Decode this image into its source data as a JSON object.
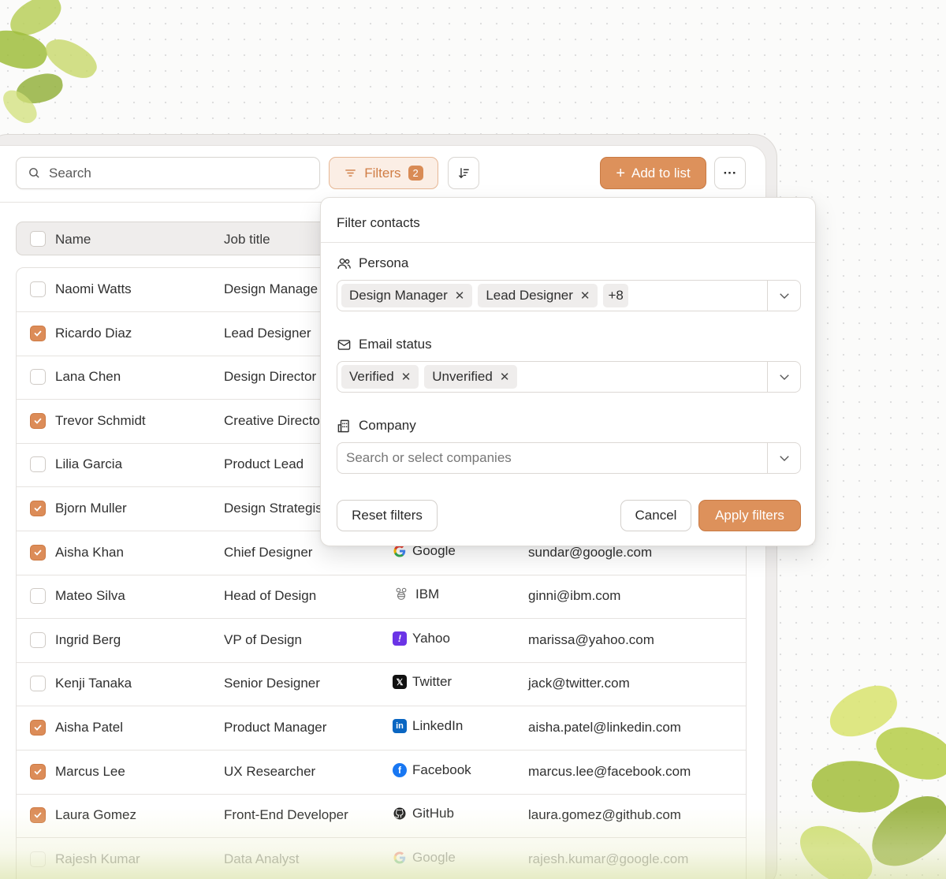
{
  "toolbar": {
    "search_placeholder": "Search",
    "filters_label": "Filters",
    "filters_count": "2",
    "add_label": "Add to list",
    "more_label": "···"
  },
  "table": {
    "columns": [
      "Name",
      "Job title"
    ],
    "rows": [
      {
        "checked": false,
        "name": "Naomi Watts",
        "job": "Design Manage",
        "company": "",
        "logo": "",
        "email": ""
      },
      {
        "checked": true,
        "name": "Ricardo Diaz",
        "job": "Lead Designer",
        "company": "",
        "logo": "",
        "email": ""
      },
      {
        "checked": false,
        "name": "Lana Chen",
        "job": "Design Director",
        "company": "",
        "logo": "",
        "email": ""
      },
      {
        "checked": true,
        "name": "Trevor Schmidt",
        "job": "Creative Directo",
        "company": "",
        "logo": "",
        "email": ""
      },
      {
        "checked": false,
        "name": "Lilia Garcia",
        "job": "Product Lead",
        "company": "",
        "logo": "",
        "email": ""
      },
      {
        "checked": true,
        "name": "Bjorn Muller",
        "job": "Design Strategis",
        "company": "",
        "logo": "",
        "email": ""
      },
      {
        "checked": true,
        "name": "Aisha Khan",
        "job": "Chief Designer",
        "company": "Google",
        "logo": "google",
        "email": "sundar@google.com"
      },
      {
        "checked": false,
        "name": "Mateo Silva",
        "job": "Head of Design",
        "company": "IBM",
        "logo": "ibm",
        "email": "ginni@ibm.com"
      },
      {
        "checked": false,
        "name": "Ingrid Berg",
        "job": "VP of Design",
        "company": "Yahoo",
        "logo": "yahoo",
        "email": "marissa@yahoo.com"
      },
      {
        "checked": false,
        "name": "Kenji Tanaka",
        "job": "Senior Designer",
        "company": "Twitter",
        "logo": "twitter",
        "email": "jack@twitter.com"
      },
      {
        "checked": true,
        "name": "Aisha Patel",
        "job": "Product Manager",
        "company": "LinkedIn",
        "logo": "linkedin",
        "email": "aisha.patel@linkedin.com"
      },
      {
        "checked": true,
        "name": "Marcus Lee",
        "job": "UX Researcher",
        "company": "Facebook",
        "logo": "facebook",
        "email": "marcus.lee@facebook.com"
      },
      {
        "checked": true,
        "name": "Laura Gomez",
        "job": "Front-End Developer",
        "company": "GitHub",
        "logo": "github",
        "email": "laura.gomez@github.com"
      },
      {
        "checked": false,
        "name": "Rajesh Kumar",
        "job": "Data Analyst",
        "company": "Google",
        "logo": "google",
        "email": "rajesh.kumar@google.com"
      }
    ]
  },
  "popover": {
    "title": "Filter contacts",
    "persona": {
      "label": "Persona",
      "chips": [
        "Design Manager",
        "Lead Designer"
      ],
      "more": "+8"
    },
    "email_status": {
      "label": "Email status",
      "chips": [
        "Verified",
        "Unverified"
      ]
    },
    "company": {
      "label": "Company",
      "placeholder": "Search or select companies"
    },
    "reset_label": "Reset filters",
    "cancel_label": "Cancel",
    "apply_label": "Apply filters"
  },
  "colors": {
    "accent": "#dd915b",
    "accent_light": "#fbeee5",
    "surface": "#efedec"
  }
}
